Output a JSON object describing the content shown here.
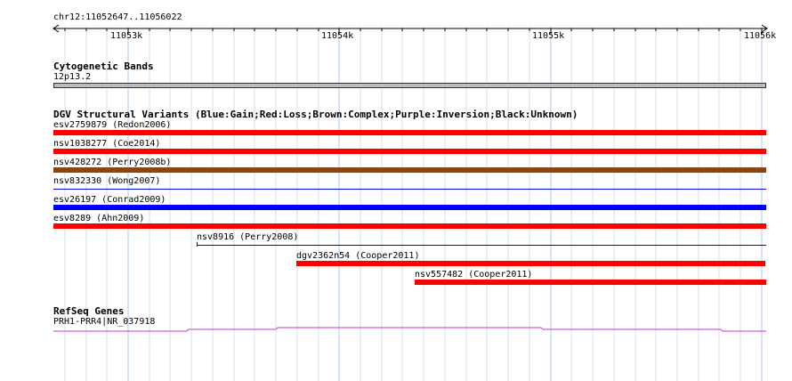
{
  "location": "chr12:11052647..11056022",
  "ruler": {
    "ticks": [
      {
        "label": "11053k",
        "pos": 11053000
      },
      {
        "label": "11054k",
        "pos": 11054000
      },
      {
        "label": "11055k",
        "pos": 11055000
      },
      {
        "label": "11056k",
        "pos": 11056000
      }
    ]
  },
  "cytoband": {
    "title": "Cytogenetic Bands",
    "band_label": "12p13.2",
    "color": "#bcbcbc"
  },
  "dgv": {
    "title": "DGV Structural Variants (Blue:Gain;Red:Loss;Brown:Complex;Purple:Inversion;Black:Unknown)",
    "variants": [
      {
        "label": "esv2759879 (Redon2006)",
        "color": "#ff0000",
        "style": "thick",
        "extends_from_view_start": true
      },
      {
        "label": "nsv1038277 (Coe2014)",
        "color": "#ff0000",
        "style": "thick",
        "extends_from_view_start": true
      },
      {
        "label": "nsv428272 (Perry2008b)",
        "color": "#8b4513",
        "style": "thick",
        "extends_from_view_start": true
      },
      {
        "label": "nsv832330 (Wong2007)",
        "color": "#0000ff",
        "style": "thin",
        "extends_from_view_start": true
      },
      {
        "label": "esv26197 (Conrad2009)",
        "color": "#0000ff",
        "style": "thick",
        "extends_from_view_start": true
      },
      {
        "label": "esv8289 (Ahn2009)",
        "color": "#ff0000",
        "style": "thick",
        "extends_from_view_start": true
      },
      {
        "label": "nsv8916 (Perry2008)",
        "color": "#0000ff",
        "style": "thin",
        "start": 11053330
      },
      {
        "label": "dgv2362n54 (Cooper2011)",
        "color": "#ff0000",
        "style": "thick",
        "start": 11053805
      },
      {
        "label": "nsv557482 (Cooper2011)",
        "color": "#ff0000",
        "style": "thick",
        "start": 11054365
      }
    ]
  },
  "refseq": {
    "title": "RefSeq Genes",
    "gene_label": "PRH1-PRR4|NR_037918",
    "color": "#cc33cc"
  }
}
